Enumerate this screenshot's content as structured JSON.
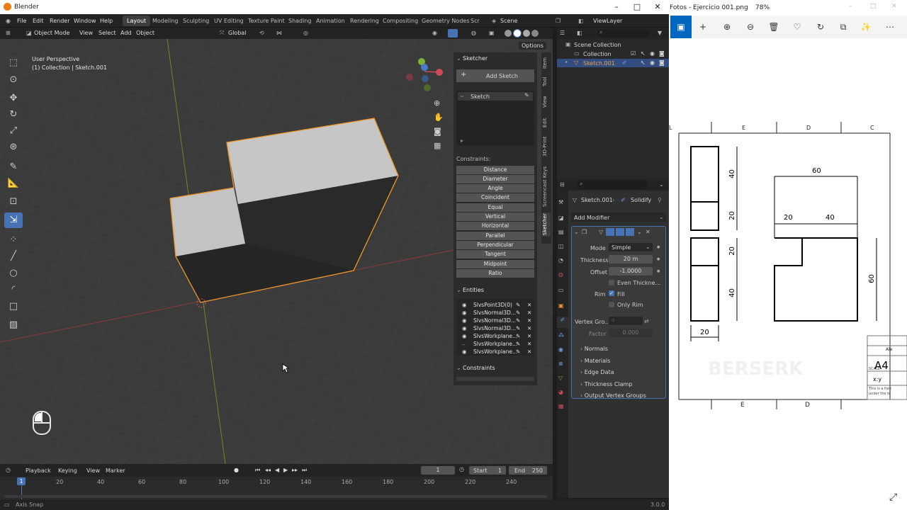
{
  "blender": {
    "window_title": "Blender",
    "menu": [
      "File",
      "Edit",
      "Render",
      "Window",
      "Help"
    ],
    "workspaces": [
      "Layout",
      "Modeling",
      "Sculpting",
      "UV Editing",
      "Texture Paint",
      "Shading",
      "Animation",
      "Rendering",
      "Compositing",
      "Geometry Nodes",
      "Scr"
    ],
    "active_workspace": "Layout",
    "scene": "Scene",
    "view_layer": "ViewLayer",
    "viewport_header": {
      "mode": "Object Mode",
      "menus": [
        "View",
        "Select",
        "Add",
        "Object"
      ],
      "transform": "Global"
    },
    "viewport": {
      "perspective": "User Perspective",
      "collection_info": "(1) Collection | Sketch.001",
      "options_label": "Options"
    },
    "sketcher_panel": {
      "title": "Sketcher",
      "add_sketch": "Add Sketch",
      "sketch_item": "Sketch",
      "constraints_label": "Constraints:",
      "constraint_buttons": [
        "Distance",
        "Diameter",
        "Angle",
        "Coincident",
        "Equal",
        "Vertical",
        "Horizontal",
        "Parallel",
        "Perpendicular",
        "Tangent",
        "Midpoint",
        "Ratio"
      ],
      "entities_title": "Entities",
      "entities": [
        "SlvsPoint3D(0)",
        "SlvsNormal3D...",
        "SlvsNormal3D...",
        "SlvsNormal3D...",
        "SlvsWorkplane...",
        "SlvsWorkplane...",
        "SlvsWorkplane..."
      ],
      "constraints_title": "Constraints"
    },
    "n_tabs": [
      "Item",
      "Tool",
      "View",
      "Edit",
      "3D-Print",
      "Screencast Keys",
      "Sketcher"
    ],
    "outliner": {
      "items": [
        {
          "label": "Scene Collection"
        },
        {
          "label": "Collection"
        },
        {
          "label": "Sketch.001"
        }
      ]
    },
    "properties": {
      "object": "Sketch.001",
      "modifier": "Solidify",
      "add_modifier": "Add Modifier",
      "mode_label": "Mode",
      "mode_value": "Simple",
      "thickness_label": "Thickness",
      "thickness_value": "20 m",
      "offset_label": "Offset",
      "offset_value": "-1.0000",
      "even_thickness": "Even Thickne...",
      "rim_label": "Rim",
      "fill": "Fill",
      "only_rim": "Only Rim",
      "vertex_group_label": "Vertex Gro...",
      "factor_label": "Factor",
      "factor_value": "0.000",
      "subpanels": [
        "Normals",
        "Materials",
        "Edge Data",
        "Thickness Clamp",
        "Output Vertex Groups"
      ]
    },
    "timeline": {
      "menus": [
        "Playback",
        "Keying",
        "View",
        "Marker"
      ],
      "current_frame": "1",
      "start_label": "Start",
      "start": "1",
      "end_label": "End",
      "end": "250",
      "ticks": [
        "1",
        "20",
        "40",
        "60",
        "80",
        "100",
        "120",
        "140",
        "160",
        "180",
        "200",
        "220",
        "240"
      ]
    },
    "status": {
      "left": "Axis Snap",
      "version": "3.0.0"
    }
  },
  "photos": {
    "title": "Fotos - Ejercicio 001.png",
    "zoom": "78%",
    "drawing": {
      "top_columns": [
        "E",
        "D",
        "C"
      ],
      "bottom_columns": [
        "E",
        "D"
      ],
      "left_dims": [
        "40",
        "20",
        "20",
        "40",
        "20"
      ],
      "right_dims": [
        "60",
        "20",
        "40",
        "60"
      ],
      "sheet_size": "A4",
      "scale": "x:y",
      "title_block_text": [
        "Ale",
        "This is a free",
        "under the te",
        "SCALE"
      ],
      "watermark": "BERSERK"
    }
  }
}
